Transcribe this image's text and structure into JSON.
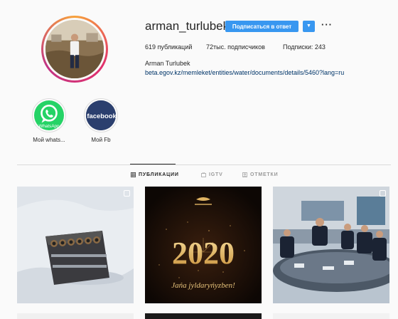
{
  "profile": {
    "username": "arman_turlubek",
    "follow_label": "Подписаться в ответ",
    "dropdown_glyph": "▼",
    "more_glyph": "···",
    "stats": {
      "posts": "619 публикаций",
      "followers": "72тыс. подписчиков",
      "following": "Подписки: 243"
    },
    "full_name": "Arman Turlubek",
    "bio_link": "beta.egov.kz/memleket/entities/water/documents/details/5460?lang=ru"
  },
  "highlights": [
    {
      "label": "Мой whats...",
      "icon": "whatsapp-icon",
      "badge_text": "WhatsApp"
    },
    {
      "label": "Мой Fb",
      "icon": "facebook-icon",
      "badge_text": "facebook"
    }
  ],
  "tabs": [
    {
      "label": "ПУБЛИКАЦИИ",
      "icon": "grid-icon",
      "active": true
    },
    {
      "label": "IGTV",
      "icon": "tv-icon",
      "active": false
    },
    {
      "label": "ОТМЕТКИ",
      "icon": "tag-icon",
      "active": false
    }
  ],
  "posts": [
    {
      "kind": "photo-snow-fireworks",
      "multi": true
    },
    {
      "kind": "greeting-2020",
      "multi": false,
      "year_text": "2020",
      "greeting": "Jańa jyldaryńyzben!"
    },
    {
      "kind": "photo-meeting",
      "multi": true
    }
  ],
  "colors": {
    "accent": "#3897f0",
    "link": "#003569",
    "border": "#dbdbdb",
    "whatsapp": "#25d366",
    "facebook": "#3b5998"
  }
}
